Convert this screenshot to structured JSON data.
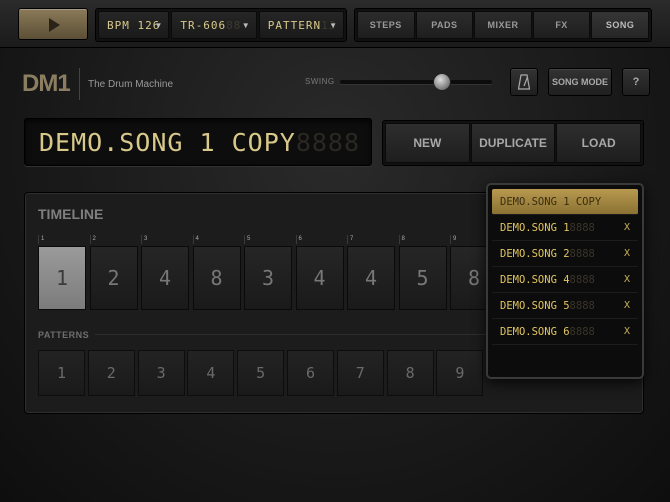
{
  "topbar": {
    "play_icon": "play-icon",
    "bpm": {
      "label": "BPM 126",
      "ghost": ""
    },
    "kit": {
      "label": "TR-606",
      "ghost": "88"
    },
    "pattern": {
      "label": "PATTERN",
      "ghost": "13"
    },
    "tabs": [
      {
        "label": "STEPS"
      },
      {
        "label": "PADS"
      },
      {
        "label": "MIXER"
      },
      {
        "label": "FX"
      },
      {
        "label": "SONG"
      }
    ]
  },
  "header": {
    "logo": "DM1",
    "subtitle": "The Drum Machine",
    "swing_label": "SWING",
    "swing_value": 0.67,
    "metronome_icon": "metronome-icon",
    "song_mode_label": "SONG MODE",
    "help_label": "?"
  },
  "song": {
    "name": "DEMO.SONG 1 COPY",
    "ghost": "8888",
    "actions": [
      {
        "label": "NEW"
      },
      {
        "label": "DUPLICATE"
      },
      {
        "label": "LOAD"
      }
    ]
  },
  "timeline": {
    "title": "TIMELINE",
    "ruler": [
      "1",
      "2",
      "3",
      "4",
      "5",
      "6",
      "7",
      "8",
      "9"
    ],
    "cells": [
      "1",
      "2",
      "4",
      "8",
      "3",
      "4",
      "4",
      "5",
      "8"
    ],
    "active_index": 0,
    "patterns_label": "PATTERNS",
    "patterns": [
      "1",
      "2",
      "3",
      "4",
      "5",
      "6",
      "7",
      "8",
      "9"
    ]
  },
  "song_list": [
    {
      "name": "DEMO.SONG 1 COPY",
      "ghost": "",
      "delete": "",
      "selected": true
    },
    {
      "name": "DEMO.SONG 1",
      "ghost": "8888",
      "delete": "X",
      "selected": false
    },
    {
      "name": "DEMO.SONG 2",
      "ghost": "8888",
      "delete": "X",
      "selected": false
    },
    {
      "name": "DEMO.SONG 4",
      "ghost": "8888",
      "delete": "X",
      "selected": false
    },
    {
      "name": "DEMO.SONG 5",
      "ghost": "8888",
      "delete": "X",
      "selected": false
    },
    {
      "name": "DEMO.SONG 6",
      "ghost": "8888",
      "delete": "X",
      "selected": false
    }
  ]
}
